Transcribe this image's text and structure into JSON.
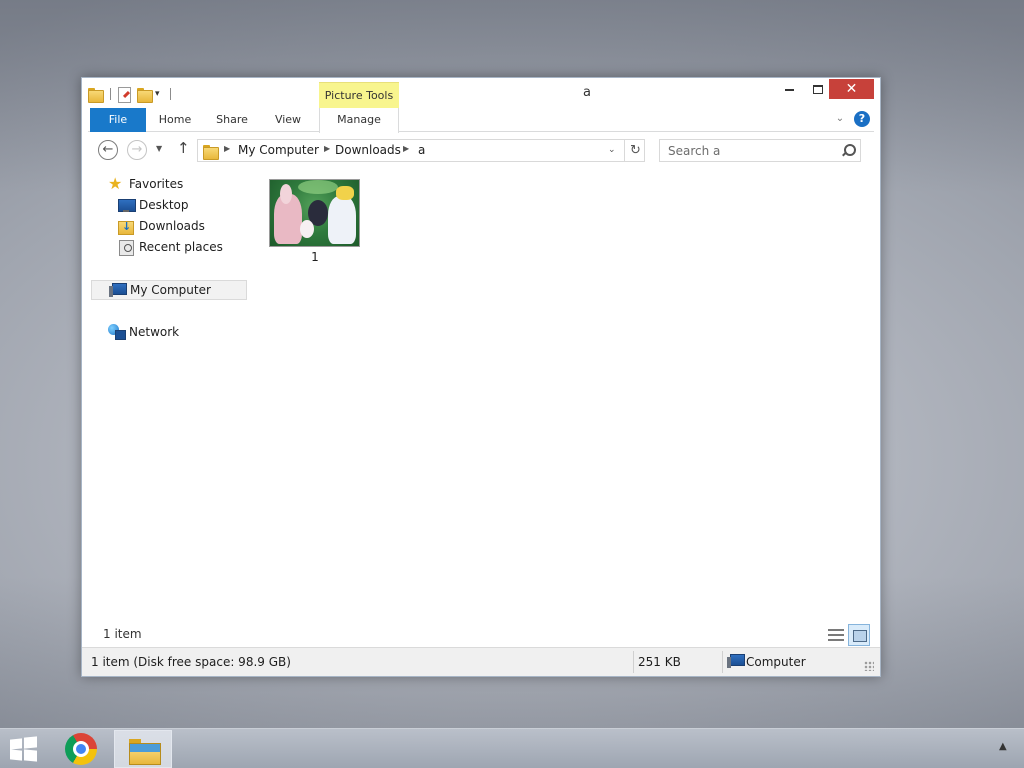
{
  "window": {
    "title": "a",
    "context_tab": "Picture Tools",
    "close_glyph": "✕"
  },
  "ribbon": {
    "tabs": [
      {
        "label": "File"
      },
      {
        "label": "Home"
      },
      {
        "label": "Share"
      },
      {
        "label": "View"
      },
      {
        "label": "Manage"
      }
    ],
    "help_glyph": "?"
  },
  "address": {
    "crumbs": [
      "My Computer",
      "Downloads",
      "a"
    ]
  },
  "search": {
    "placeholder": "Search a"
  },
  "nav_pane": {
    "favorites": {
      "label": "Favorites",
      "icon": "star-icon"
    },
    "favorite_items": [
      {
        "label": "Desktop",
        "icon": "desktop-icon"
      },
      {
        "label": "Downloads",
        "icon": "downloads-icon"
      },
      {
        "label": "Recent places",
        "icon": "recent-places-icon"
      }
    ],
    "computer": {
      "label": "My Computer",
      "icon": "computer-icon"
    },
    "network": {
      "label": "Network",
      "icon": "network-icon"
    }
  },
  "files": [
    {
      "name": "1",
      "type": "image-thumbnail"
    }
  ],
  "status": {
    "item_count": "1 item",
    "selection_info": "1 item (Disk free space: 98.9 GB)",
    "size": "251 KB",
    "location": "Computer"
  },
  "taskbar": {
    "apps": [
      "start",
      "chrome",
      "file-explorer"
    ],
    "tray_glyph": "▲"
  },
  "colors": {
    "file_tab": "#1979ca",
    "picture_tools": "#f8f58e",
    "close_button": "#c7413a"
  }
}
